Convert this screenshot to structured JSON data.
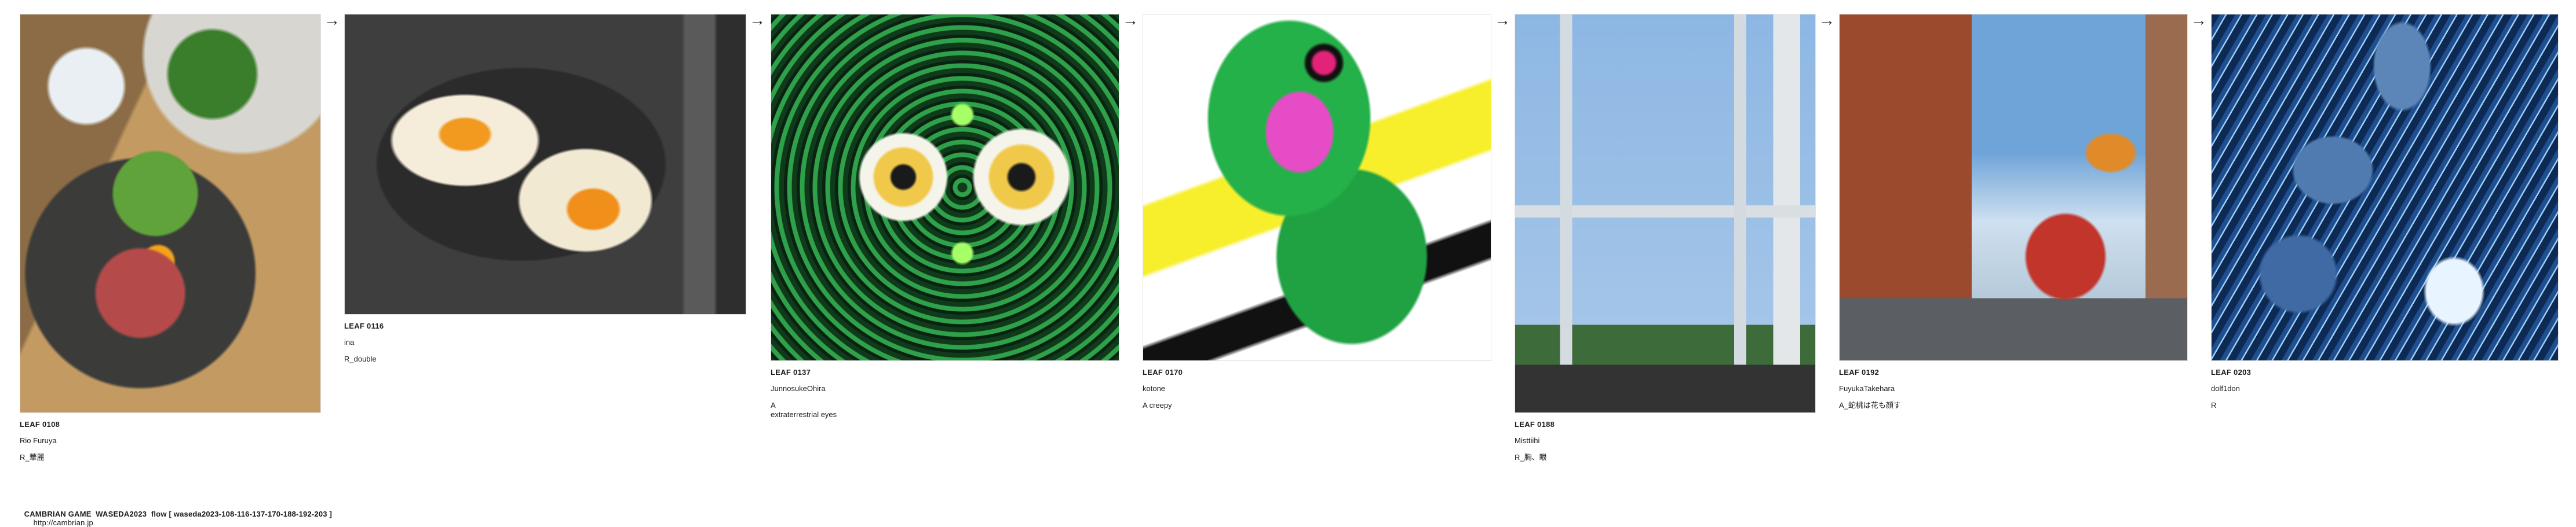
{
  "leaves": [
    {
      "id": "leaf-0108",
      "title": "LEAF 0108",
      "author": "Rio Furuya",
      "text": "R_華麗"
    },
    {
      "id": "leaf-0116",
      "title": "LEAF 0116",
      "author": "ina",
      "text": "R_double"
    },
    {
      "id": "leaf-0137",
      "title": "LEAF 0137",
      "author": "JunnosukeOhira",
      "text": "A\nextraterrestrial eyes"
    },
    {
      "id": "leaf-0170",
      "title": "LEAF 0170",
      "author": "kotone",
      "text": "A creepy"
    },
    {
      "id": "leaf-0188",
      "title": "LEAF 0188",
      "author": "Misttiihi",
      "text": "R_胸、眼"
    },
    {
      "id": "leaf-0192",
      "title": "LEAF 0192",
      "author": "FuyukaTakehara",
      "text": "A_蛇桃は花も顔す"
    },
    {
      "id": "leaf-0203",
      "title": "LEAF 0203",
      "author": "dolf1don",
      "text": "R"
    }
  ],
  "arrow_glyph": "→",
  "footer": {
    "label": "CAMBRIAN GAME  WASEDA2023  flow [ waseda2023-108-116-137-170-188-192-203 ]",
    "url": "http://cambrian.jp"
  }
}
